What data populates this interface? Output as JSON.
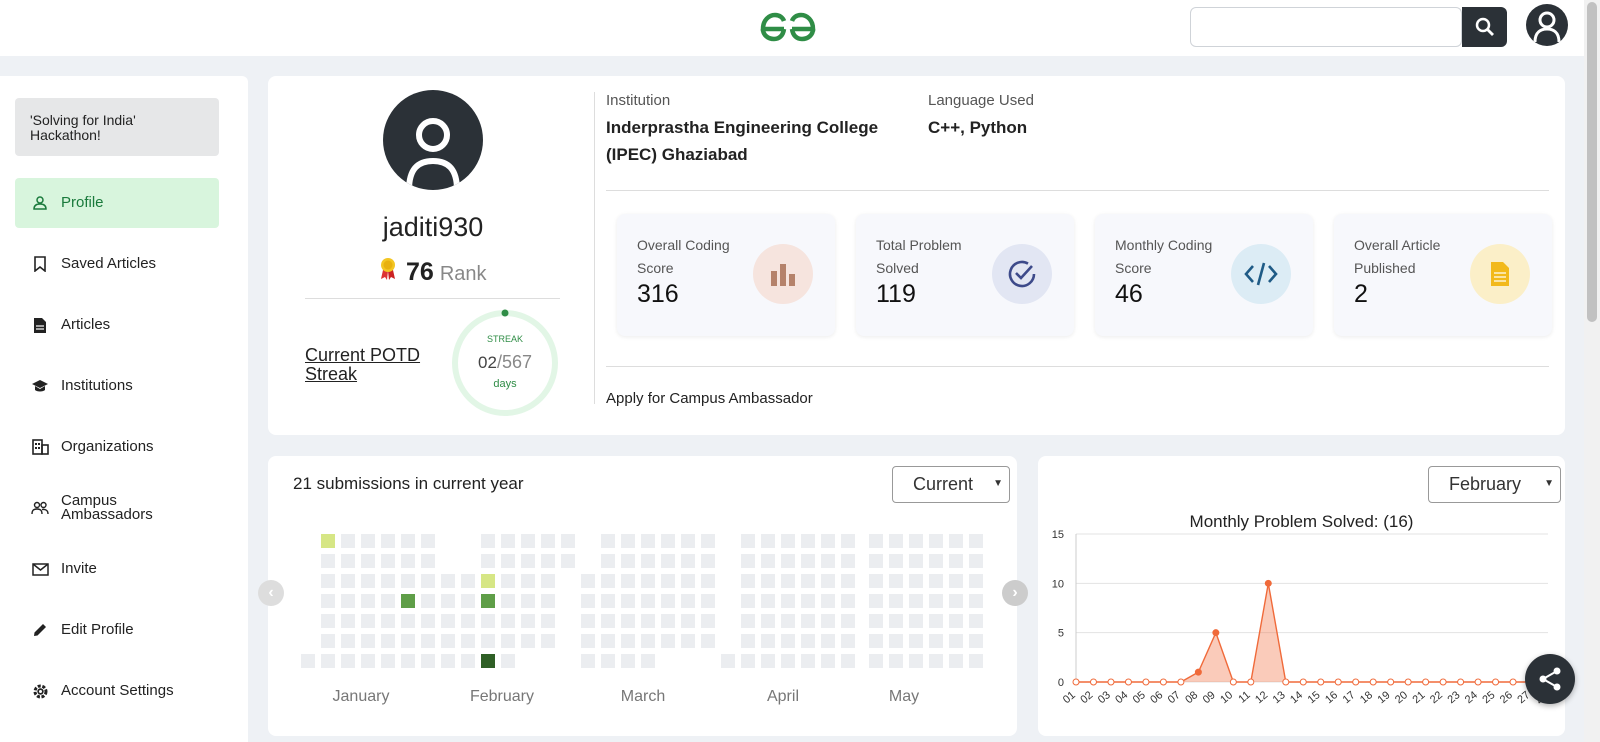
{
  "header": {
    "search_placeholder": ""
  },
  "sidebar": {
    "hackathon": "'Solving for India' Hackathon!",
    "items": [
      {
        "label": "Profile",
        "icon": "person-icon"
      },
      {
        "label": "Saved Articles",
        "icon": "bookmark-icon"
      },
      {
        "label": "Articles",
        "icon": "document-icon"
      },
      {
        "label": "Institutions",
        "icon": "graduation-cap-icon"
      },
      {
        "label": "Organizations",
        "icon": "building-icon"
      },
      {
        "label": "Campus Ambassadors",
        "icon": "people-icon"
      },
      {
        "label": "Invite",
        "icon": "envelope-icon"
      },
      {
        "label": "Edit Profile",
        "icon": "pencil-icon"
      },
      {
        "label": "Account Settings",
        "icon": "gear-icon"
      }
    ]
  },
  "profile": {
    "username": "jaditi930",
    "rank_value": "76",
    "rank_label": "Rank",
    "potd_label": "Current POTD Streak",
    "streak_label": "STREAK",
    "streak_current": "02",
    "streak_total": "/567",
    "streak_unit": "days",
    "institution_label": "Institution",
    "institution_value": "Inderprastha Engineering College (IPEC) Ghaziabad",
    "language_label": "Language Used",
    "language_value": "C++, Python",
    "ambassador_link": "Apply for Campus Ambassador"
  },
  "stats": [
    {
      "title": "Overall Coding Score",
      "value": "316",
      "color": "#f6e4de",
      "icon": "bar-chart-icon"
    },
    {
      "title": "Total Problem Solved",
      "value": "119",
      "color": "#e2e6f3",
      "icon": "check-circle-icon"
    },
    {
      "title": "Monthly Coding Score",
      "value": "46",
      "color": "#dcecf5",
      "icon": "code-icon"
    },
    {
      "title": "Overall Article Published",
      "value": "2",
      "color": "#fbefc8",
      "icon": "article-icon"
    }
  ],
  "calendar": {
    "title": "21 submissions in current year",
    "select_value": "Current",
    "months": [
      "January",
      "February",
      "March",
      "April",
      "May"
    ]
  },
  "monthly_chart": {
    "select_value": "February",
    "accent": "#f06a3a"
  },
  "chart_data": {
    "type": "area",
    "title": "Monthly Problem Solved: (16)",
    "x": [
      "01",
      "02",
      "03",
      "04",
      "05",
      "06",
      "07",
      "08",
      "09",
      "10",
      "11",
      "12",
      "13",
      "14",
      "15",
      "16",
      "17",
      "18",
      "19",
      "20",
      "21",
      "22",
      "23",
      "24",
      "25",
      "26",
      "27",
      "28"
    ],
    "values": [
      0,
      0,
      0,
      0,
      0,
      0,
      0,
      1,
      5,
      0,
      0,
      10,
      0,
      0,
      0,
      0,
      0,
      0,
      0,
      0,
      0,
      0,
      0,
      0,
      0,
      0,
      0,
      0
    ],
    "yticks": [
      0,
      5,
      10,
      15
    ],
    "ylim": [
      0,
      15
    ],
    "grid": true
  }
}
